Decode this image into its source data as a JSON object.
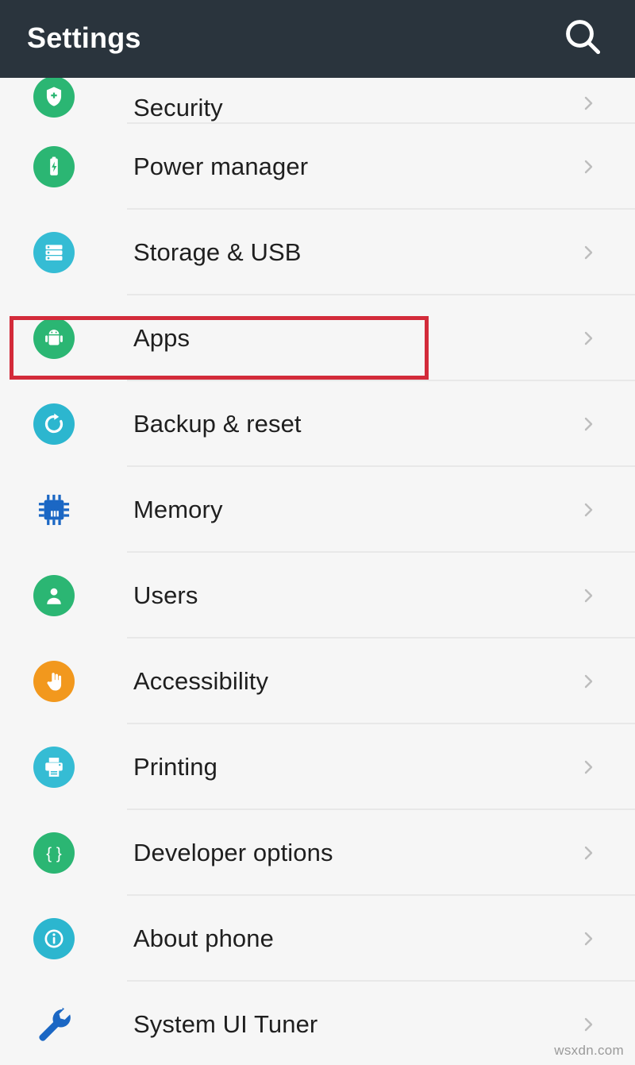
{
  "header": {
    "title": "Settings",
    "search_icon": "search-icon",
    "background_color": "#2a343d",
    "title_color": "#ffffff"
  },
  "list": {
    "background_color": "#f6f6f6",
    "divider_color": "#e8e8e8",
    "chevron_icon": "chevron-right-icon",
    "chevron_color": "#bdbdbd",
    "items": [
      {
        "label": "Security",
        "icon": "shield-icon",
        "icon_color": "#2bb673",
        "icon_shape": "circle",
        "partial": true
      },
      {
        "label": "Power manager",
        "icon": "battery-icon",
        "icon_color": "#2bb673",
        "icon_shape": "circle",
        "partial": false
      },
      {
        "label": "Storage & USB",
        "icon": "storage-icon",
        "icon_color": "#35bcd4",
        "icon_shape": "circle",
        "partial": false
      },
      {
        "label": "Apps",
        "icon": "android-icon",
        "icon_color": "#2bb673",
        "icon_shape": "circle",
        "partial": false,
        "highlighted": true
      },
      {
        "label": "Backup & reset",
        "icon": "refresh-icon",
        "icon_color": "#2cb6cf",
        "icon_shape": "circle",
        "partial": false
      },
      {
        "label": "Memory",
        "icon": "memory-chip-icon",
        "icon_color": "#1b67c4",
        "icon_shape": "glyph",
        "partial": false
      },
      {
        "label": "Users",
        "icon": "person-icon",
        "icon_color": "#2bb673",
        "icon_shape": "circle",
        "partial": false
      },
      {
        "label": "Accessibility",
        "icon": "hand-pointer-icon",
        "icon_color": "#f2981d",
        "icon_shape": "circle",
        "partial": false
      },
      {
        "label": "Printing",
        "icon": "printer-icon",
        "icon_color": "#35bcd4",
        "icon_shape": "circle",
        "partial": false
      },
      {
        "label": "Developer options",
        "icon": "braces-icon",
        "icon_color": "#2bb673",
        "icon_shape": "circle",
        "partial": false
      },
      {
        "label": "About phone",
        "icon": "info-icon",
        "icon_color": "#2cb6cf",
        "icon_shape": "circle",
        "partial": false
      },
      {
        "label": "System UI Tuner",
        "icon": "wrench-icon",
        "icon_color": "#1b67c4",
        "icon_shape": "glyph",
        "partial": false
      }
    ]
  },
  "annotation": {
    "target_label": "Apps",
    "color": "#d32b3a"
  },
  "watermark": {
    "text": "wsxdn.com"
  }
}
